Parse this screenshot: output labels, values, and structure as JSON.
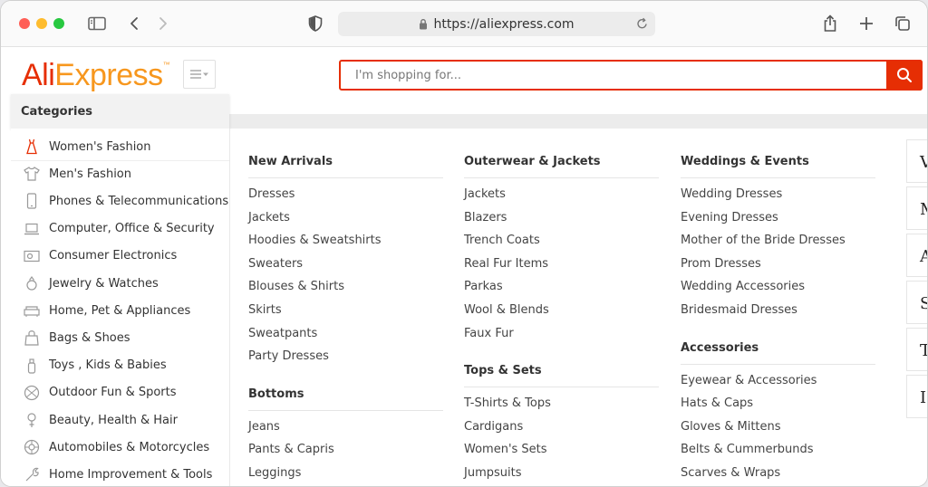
{
  "browser": {
    "url": "https://aliexpress.com"
  },
  "header": {
    "logo_ali": "Ali",
    "logo_express": "Express",
    "logo_tm": "™",
    "search_placeholder": "I'm shopping for..."
  },
  "categories": {
    "title": "Categories",
    "items": [
      {
        "label": "Women's Fashion",
        "icon": "dress-icon"
      },
      {
        "label": "Men's Fashion",
        "icon": "shirt-icon"
      },
      {
        "label": "Phones & Telecommunications",
        "icon": "phone-icon"
      },
      {
        "label": "Computer, Office & Security",
        "icon": "laptop-icon"
      },
      {
        "label": "Consumer Electronics",
        "icon": "camera-icon"
      },
      {
        "label": "Jewelry & Watches",
        "icon": "ring-icon"
      },
      {
        "label": "Home, Pet & Appliances",
        "icon": "sofa-icon"
      },
      {
        "label": "Bags & Shoes",
        "icon": "bag-icon"
      },
      {
        "label": "Toys , Kids & Babies",
        "icon": "bottle-icon"
      },
      {
        "label": "Outdoor Fun & Sports",
        "icon": "ball-icon"
      },
      {
        "label": "Beauty, Health & Hair",
        "icon": "lipstick-icon"
      },
      {
        "label": "Automobiles & Motorcycles",
        "icon": "wheel-icon"
      },
      {
        "label": "Home Improvement & Tools",
        "icon": "tools-icon"
      }
    ]
  },
  "columns": [
    {
      "sections": [
        {
          "title": "New Arrivals",
          "links": [
            "Dresses",
            "Jackets",
            "Hoodies & Sweatshirts",
            "Sweaters",
            "Blouses & Shirts",
            "Skirts",
            "Sweatpants",
            "Party Dresses"
          ]
        },
        {
          "title": "Bottoms",
          "links": [
            "Jeans",
            "Pants & Capris",
            "Leggings"
          ]
        }
      ]
    },
    {
      "sections": [
        {
          "title": "Outerwear & Jackets",
          "links": [
            "Jackets",
            "Blazers",
            "Trench Coats",
            "Real Fur Items",
            "Parkas",
            "Wool & Blends",
            "Faux Fur"
          ]
        },
        {
          "title": "Tops & Sets",
          "links": [
            "T-Shirts & Tops",
            "Cardigans",
            "Women's Sets",
            "Jumpsuits"
          ]
        }
      ]
    },
    {
      "sections": [
        {
          "title": "Weddings & Events",
          "links": [
            "Wedding Dresses",
            "Evening Dresses",
            "Mother of the Bride Dresses",
            "Prom Dresses",
            "Wedding Accessories",
            "Bridesmaid Dresses"
          ]
        },
        {
          "title": "Accessories",
          "links": [
            "Eyewear & Accessories",
            "Hats & Caps",
            "Gloves & Mittens",
            "Belts & Cummerbunds",
            "Scarves & Wraps"
          ]
        }
      ]
    }
  ],
  "right_strip": [
    "V",
    "M",
    "A",
    "S",
    "T",
    "I"
  ],
  "colors": {
    "brand_red": "#e62e04",
    "brand_orange": "#f7971e"
  }
}
